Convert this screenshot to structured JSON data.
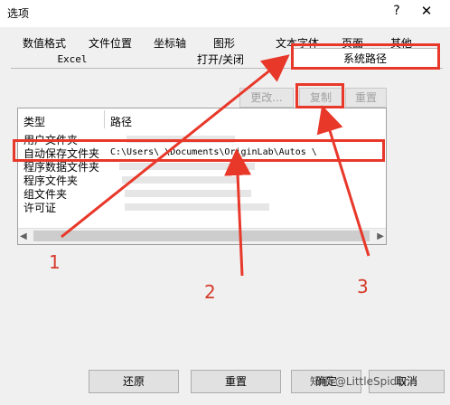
{
  "window": {
    "title": "选项",
    "help_glyph": "?",
    "close_glyph": "✕"
  },
  "tabs_row1": [
    "数值格式",
    "文件位置",
    "坐标轴",
    "图形",
    "文本字体",
    "页面",
    "其他"
  ],
  "tabs_row2": [
    "Excel",
    "打开/关闭"
  ],
  "selected_tab": "系统路径",
  "actions": {
    "modify": "更改...",
    "copy": "复制",
    "reset": "重置"
  },
  "list": {
    "headers": {
      "type": "类型",
      "path": "路径"
    },
    "rows": [
      {
        "type": "用户文件夹",
        "path": ""
      },
      {
        "type": "自动保存文件夹",
        "path": "C:\\Users\\        \\Documents\\OriginLab\\Autos   \\"
      },
      {
        "type": "程序数据文件夹",
        "path": ""
      },
      {
        "type": "程序文件夹",
        "path": ""
      },
      {
        "type": "组文件夹",
        "path": ""
      },
      {
        "type": "许可证",
        "path": ""
      }
    ]
  },
  "buttons": {
    "restore": "还原",
    "reset": "重置",
    "ok": "确定",
    "cancel": "取消"
  },
  "annotations": {
    "one": "1",
    "two": "2",
    "three": "3"
  },
  "watermark": "知乎 @LittleSpider",
  "colors": {
    "annotation": "#e8382a",
    "selection_outline": "#e8382a"
  }
}
